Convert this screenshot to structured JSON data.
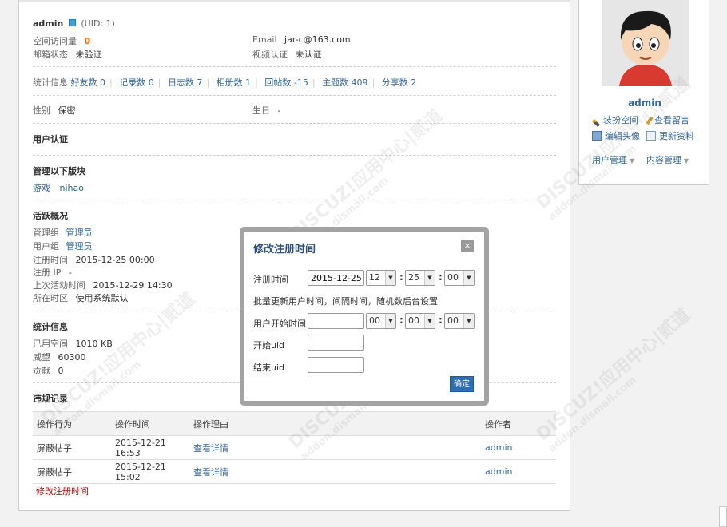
{
  "profile": {
    "username": "admin",
    "uid": "(UID: 1)",
    "visits_label": "空间访问量",
    "visits_value": "0",
    "email_label": "Email",
    "email_value": "jar-c@163.com",
    "mail_status_label": "邮箱状态",
    "mail_status_value": "未验证",
    "video_label": "视频认证",
    "video_value": "未认证"
  },
  "stats": {
    "label": "统计信息",
    "items": [
      "好友数 0",
      "记录数 0",
      "日志数 7",
      "相册数 1",
      "回帖数 -15",
      "主题数 409",
      "分享数 2"
    ]
  },
  "info": {
    "gender_label": "性别",
    "gender_value": "保密",
    "birthday_label": "生日",
    "birthday_value": "-"
  },
  "sections": {
    "auth": "用户认证",
    "forums": "管理以下版块",
    "forum_links": [
      "游戏",
      "nihao"
    ],
    "activity": "活跃概况",
    "stats2": "统计信息",
    "violations": "违规记录"
  },
  "activity": {
    "admin_group_label": "管理组",
    "admin_group_value": "管理员",
    "user_group_label": "用户组",
    "user_group_value": "管理员",
    "reg_time_label": "注册时间",
    "reg_time_value": "2015-12-25 00:00",
    "reg_ip_label": "注册 IP",
    "reg_ip_value": "-",
    "last_active_label": "上次活动时间",
    "last_active_value": "2015-12-29 14:30",
    "timezone_label": "所在时区",
    "timezone_value": "使用系统默认"
  },
  "stats2": {
    "space_label": "已用空间",
    "space_value": "1010 KB",
    "prestige_label": "威望",
    "prestige_value": "60300",
    "contrib_label": "贡献",
    "contrib_value": "0"
  },
  "log": {
    "headers": [
      "操作行为",
      "操作时间",
      "操作理由",
      "操作者"
    ],
    "rows": [
      {
        "action": "屏蔽帖子",
        "time": "2015-12-21 16:53",
        "reason": "查看详情",
        "operator": "admin"
      },
      {
        "action": "屏蔽帖子",
        "time": "2015-12-21 15:02",
        "reason": "查看详情",
        "operator": "admin"
      }
    ],
    "footer_link": "修改注册时间"
  },
  "side": {
    "name": "admin",
    "links": [
      "装扮空间",
      "查看留言",
      "编辑头像",
      "更新资料"
    ],
    "menus": [
      "用户管理",
      "内容管理"
    ]
  },
  "dialog": {
    "title": "修改注册时间",
    "close": "×",
    "reg_time_label": "注册时间",
    "reg_date": "2015-12-25",
    "hour": "12",
    "minute": "25",
    "second": "00",
    "hint": "批量更新用户时间，间隔时间，随机数后台设置",
    "start_time_label": "用户开始时间",
    "start_hour": "00",
    "start_minute": "00",
    "start_second": "00",
    "start_uid_label": "开始uid",
    "end_uid_label": "结束uid",
    "ok": "确定"
  },
  "watermark": {
    "line1": "DISCUZ!应用中心|贰道",
    "line2": "addon.dismall.com"
  },
  "colors": {
    "link": "#336699",
    "accent_orange": "#ff6600",
    "dialog_title": "#2c4f78",
    "button": "#2a6fb5"
  }
}
